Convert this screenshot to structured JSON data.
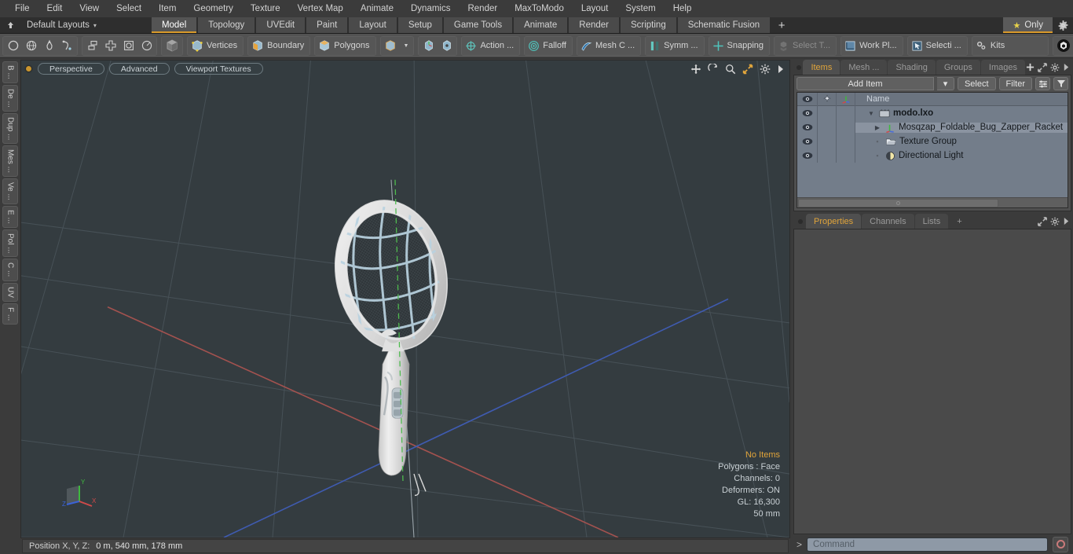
{
  "app": {
    "title": "modo",
    "accent": "#d99a2b",
    "viewport_bg": "#343c40"
  },
  "menubar": {
    "items": [
      "File",
      "Edit",
      "View",
      "Select",
      "Item",
      "Geometry",
      "Texture",
      "Vertex Map",
      "Animate",
      "Dynamics",
      "Render",
      "MaxToModo",
      "Layout",
      "System",
      "Help"
    ]
  },
  "layoutbar": {
    "layout_name": "Default Layouts",
    "layout_caret": "▾",
    "tabs": [
      {
        "label": "Model",
        "active": true
      },
      {
        "label": "Topology",
        "active": false
      },
      {
        "label": "UVEdit",
        "active": false
      },
      {
        "label": "Paint",
        "active": false
      },
      {
        "label": "Layout",
        "active": false
      },
      {
        "label": "Setup",
        "active": false
      },
      {
        "label": "Game Tools",
        "active": false
      },
      {
        "label": "Animate",
        "active": false
      },
      {
        "label": "Render",
        "active": false
      },
      {
        "label": "Scripting",
        "active": false
      },
      {
        "label": "Schematic Fusion",
        "active": false
      }
    ],
    "add_tab": "+",
    "only_label": "Only",
    "only_star": "★"
  },
  "toolbar": {
    "primitives": [
      "circle-icon",
      "globe-icon",
      "pen-icon",
      "curve-icon"
    ],
    "ops": [
      "array-icon",
      "mirror-icon",
      "boolean-icon",
      "radial-icon"
    ],
    "cube_label": "",
    "selection_modes": [
      {
        "label": "Vertices",
        "icon": "vertices-icon"
      },
      {
        "label": "Boundary",
        "icon": "boundary-icon"
      },
      {
        "label": "Polygons",
        "icon": "polygons-icon"
      }
    ],
    "items": [
      {
        "label": "Action ...",
        "icon": "action-center-icon",
        "dim": false
      },
      {
        "label": "Falloff",
        "icon": "falloff-icon",
        "dim": false
      },
      {
        "label": "Mesh C ...",
        "icon": "mesh-constraint-icon",
        "dim": false
      },
      {
        "label": "Symm ...",
        "icon": "symmetry-icon",
        "dim": false
      },
      {
        "label": "Snapping",
        "icon": "snapping-icon",
        "dim": false
      },
      {
        "label": "Select T...",
        "icon": "select-through-icon",
        "dim": true
      },
      {
        "label": "Work Pl...",
        "icon": "work-plane-icon",
        "dim": false
      },
      {
        "label": "Selecti ...",
        "icon": "selection-set-icon",
        "dim": false
      }
    ],
    "kits_label": "Kits"
  },
  "left_tabs": [
    {
      "label": "B ..."
    },
    {
      "label": "De ..."
    },
    {
      "label": "Dup ..."
    },
    {
      "label": "Mes ..."
    },
    {
      "label": "Ve ..."
    },
    {
      "label": "E ..."
    },
    {
      "label": "Pol ..."
    },
    {
      "label": "C ..."
    },
    {
      "label": "UV"
    },
    {
      "label": "F ..."
    }
  ],
  "viewport": {
    "pills": [
      "Perspective",
      "Advanced",
      "Viewport Textures"
    ],
    "tools": [
      "move-icon",
      "rotate-icon",
      "zoom-icon",
      "maximize-icon",
      "gear-icon",
      "chevron-right-icon"
    ],
    "stats": {
      "selection": "No Items",
      "polygons": "Polygons : Face",
      "channels": "Channels: 0",
      "deformers": "Deformers: ON",
      "gl": "GL: 16,300",
      "scale": "50 mm"
    },
    "axis": {
      "x": "X",
      "y": "Y",
      "z": "Z",
      "x_color": "#d04a4a",
      "y_color": "#3fb83f",
      "z_color": "#3b63d8"
    },
    "model": {
      "name": "Foldable Bug Zapper Racket",
      "frame_color": "#dcdcdc",
      "mesh_color": "#32373b",
      "wire_color": "#b7cfdd"
    }
  },
  "statusbar": {
    "label": "Position X, Y, Z:",
    "value": "0 m, 540 mm, 178 mm"
  },
  "right_panel": {
    "tabs": [
      {
        "label": "Items",
        "active": true
      },
      {
        "label": "Mesh ...",
        "active": false
      },
      {
        "label": "Shading",
        "active": false
      },
      {
        "label": "Groups",
        "active": false
      },
      {
        "label": "Images",
        "active": false
      }
    ],
    "tab_tools": [
      "plus-icon",
      "expand-icon",
      "gear-icon",
      "chevron-right-icon"
    ],
    "controls": {
      "add_item": "Add Item",
      "add_item_caret": "▾",
      "select": "Select",
      "filter": "Filter",
      "list_icon": "list-options-icon",
      "funnel_icon": "funnel-icon"
    },
    "tree": {
      "columns": [
        "eye-icon",
        "lock-icon",
        "axis-icon",
        "Name"
      ],
      "rows": [
        {
          "name": "modo.lxo",
          "icon": "scene-icon",
          "depth": 0,
          "bold": true,
          "twisty": "▼",
          "selected": false
        },
        {
          "name": "Mosqzap_Foldable_Bug_Zapper_Racket",
          "icon": "locator-icon",
          "depth": 1,
          "bold": false,
          "twisty": "▶",
          "selected": true
        },
        {
          "name": "Texture Group",
          "icon": "texture-group-icon",
          "depth": 1,
          "bold": false,
          "twisty": "",
          "selected": false
        },
        {
          "name": "Directional Light",
          "icon": "light-icon",
          "depth": 1,
          "bold": false,
          "twisty": "",
          "selected": false
        }
      ]
    },
    "lower_tabs": [
      {
        "label": "Properties",
        "active": true
      },
      {
        "label": "Channels",
        "active": false
      },
      {
        "label": "Lists",
        "active": false
      },
      {
        "label": "+",
        "active": false
      }
    ],
    "lower_tab_tools": [
      "expand-icon",
      "gear-icon",
      "chevron-right-icon"
    ]
  },
  "command_bar": {
    "arrow": ">",
    "placeholder": "Command",
    "record_icon": "record-icon"
  }
}
